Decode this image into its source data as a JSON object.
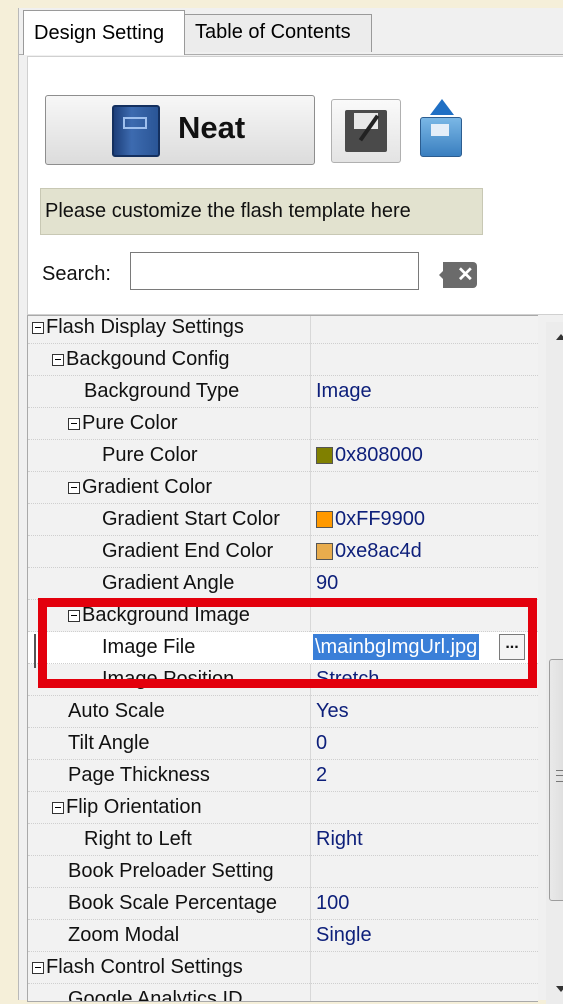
{
  "tabs": [
    {
      "label": "Design Setting",
      "active": true
    },
    {
      "label": "Table of Contents",
      "active": false
    }
  ],
  "toolbar": {
    "template_button_label": "Neat",
    "template_icon": "book-icon",
    "save_icon": "save-icon",
    "export_icon": "upload-icon"
  },
  "hint": "Please customize the flash template here",
  "search": {
    "label": "Search:",
    "value": "",
    "clear_icon": "clear-search-icon"
  },
  "properties": [
    {
      "name": "Flash Display Settings",
      "value": "",
      "group": true,
      "level": 0
    },
    {
      "name": "Backgound Config",
      "value": "",
      "group": true,
      "level": 1
    },
    {
      "name": "Background Type",
      "value": "Image",
      "group": false,
      "level": 3
    },
    {
      "name": "Pure Color",
      "value": "",
      "group": true,
      "level": 2
    },
    {
      "name": "Pure Color",
      "value": "0x808000",
      "swatch": "#808000",
      "group": false,
      "level": 4
    },
    {
      "name": "Gradient Color",
      "value": "",
      "group": true,
      "level": 2
    },
    {
      "name": "Gradient Start Color",
      "value": "0xFF9900",
      "swatch": "#FF9900",
      "group": false,
      "level": 4
    },
    {
      "name": "Gradient End Color",
      "value": "0xe8ac4d",
      "swatch": "#e8ac4d",
      "group": false,
      "level": 4
    },
    {
      "name": "Gradient Angle",
      "value": "90",
      "group": false,
      "level": 4
    },
    {
      "name": "Background Image",
      "value": "",
      "group": true,
      "level": 2
    },
    {
      "name": "Image File",
      "value": "\\mainbgImgUrl.jpg",
      "group": false,
      "level": 4,
      "editing": true
    },
    {
      "name": "Image Position",
      "value": "Stretch",
      "group": false,
      "level": 4
    },
    {
      "name": "Auto Scale",
      "value": "Yes",
      "group": false,
      "level": 2
    },
    {
      "name": "Tilt Angle",
      "value": "0",
      "group": false,
      "level": 2
    },
    {
      "name": "Page Thickness",
      "value": "2",
      "group": false,
      "level": 2
    },
    {
      "name": "Flip Orientation",
      "value": "",
      "group": true,
      "level": 1
    },
    {
      "name": "Right to Left",
      "value": "Right",
      "group": false,
      "level": 3
    },
    {
      "name": "Book Preloader Setting",
      "value": "",
      "group": false,
      "level": 2
    },
    {
      "name": "Book Scale Percentage",
      "value": "100",
      "group": false,
      "level": 2
    },
    {
      "name": "Zoom Modal",
      "value": "Single",
      "group": false,
      "level": 2
    },
    {
      "name": "Flash Control Settings",
      "value": "",
      "group": true,
      "level": 0
    },
    {
      "name": "Google Analytics ID",
      "value": "",
      "group": false,
      "level": 2
    }
  ],
  "editor_button_label": "...",
  "colors": {
    "highlight": "#e3000d",
    "selection": "#3a7fd8",
    "value_text": "#0d1f7a"
  }
}
